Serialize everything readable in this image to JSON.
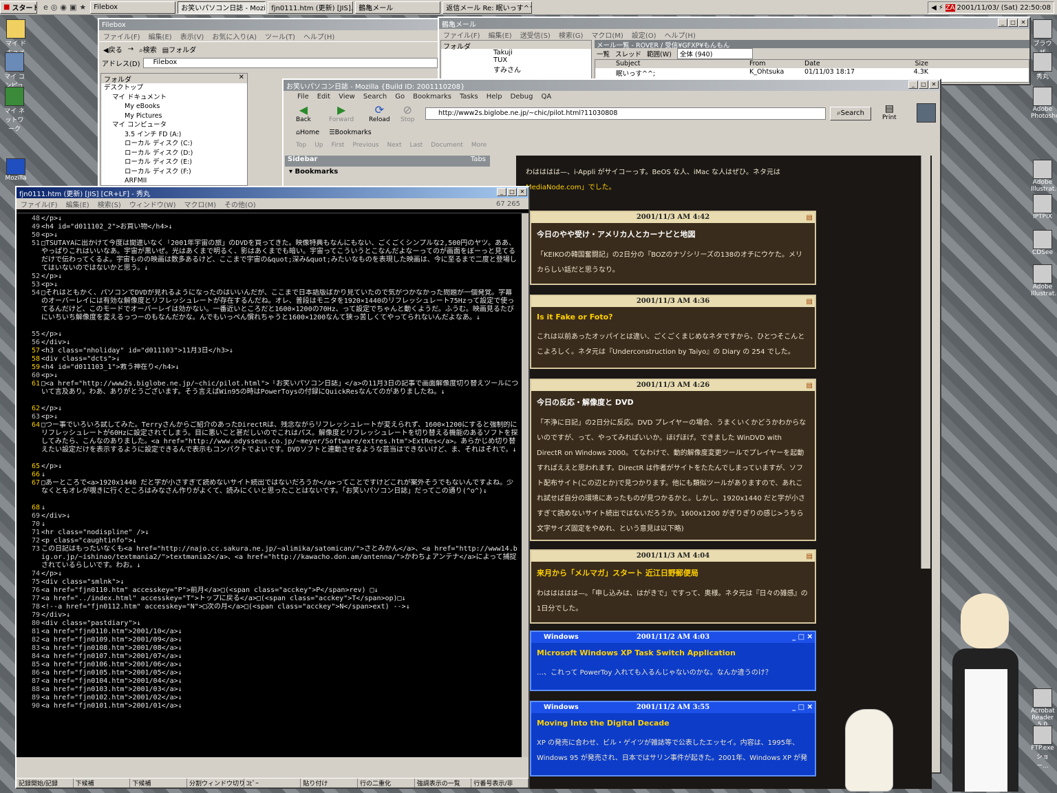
{
  "taskbar": {
    "start": "スタート",
    "tasks": [
      "Filebox",
      "お笑いパソコン日誌 - Mozi...",
      "fjn0111.htm (更新) [JIS]...",
      "鶴亀メール",
      "返信メール Re: 眠いっす^^..."
    ],
    "clock": "2001/11/03/ (Sat) 22:50:08"
  },
  "desktop": {
    "icons_left": [
      "マイ ドキュメント",
      "マイ コンピュータ",
      "マイ ネットワーク",
      "Mozilla"
    ],
    "icons_right": [
      "ブラウザ",
      "秀丸",
      "Adobe Photosho...",
      "Adobe Illustrat...",
      "IPTPIX",
      "CDSee",
      "Adobe Illustrat...",
      "Acrobat Reader 5.0",
      "FTP.exe ショー..."
    ]
  },
  "filebox": {
    "title": "Filebox",
    "menu": [
      "ファイル(F)",
      "編集(E)",
      "表示(V)",
      "お気に入り(A)",
      "ツール(T)",
      "ヘルプ(H)"
    ],
    "toolbar": [
      "戻る",
      "→",
      "検索",
      "フォルダ"
    ],
    "address_label": "アドレス(D)",
    "address": "Filebox",
    "folder_label": "フォルダ",
    "tree": [
      "デスクトップ",
      "マイ ドキュメント",
      "My eBooks",
      "My Pictures",
      "マイ コンピュータ",
      "3.5 インチ FD (A:)",
      "ローカル ディスク (C:)",
      "ローカル ディスク (D:)",
      "ローカル ディスク (E:)",
      "ローカル ディスク (F:)",
      "ARFMII"
    ]
  },
  "mail": {
    "title": "鶴亀メール",
    "menu": [
      "ファイル(F)",
      "編集(E)",
      "送受信(S)",
      "検索(G)",
      "マクロ(M)",
      "設定(O)",
      "ヘルプ(H)"
    ],
    "folder_label": "フォルダ",
    "path": "メール一覧 - ROVER / 受信¥GFXP¥もんもん",
    "folders": [
      "Takuji",
      "TUX",
      "すみさん"
    ],
    "tabs": [
      "一覧",
      "スレッド",
      "範囲(W)"
    ],
    "range": "全体 (940)",
    "cols": [
      "Subject",
      "From",
      "Date",
      "Size"
    ],
    "row": [
      "眠いっす^^;",
      "K_Ohtsuka",
      "01/11/03 18:17",
      "4.3K"
    ]
  },
  "mozilla": {
    "title": "お笑いパソコン日誌 - Mozilla {Build ID: 2001110208}",
    "menu": [
      "File",
      "Edit",
      "View",
      "Search",
      "Go",
      "Bookmarks",
      "Tasks",
      "Help",
      "Debug",
      "QA"
    ],
    "nav": [
      "Back",
      "Forward",
      "Reload",
      "Stop"
    ],
    "url": "http://www2s.biglobe.ne.jp/~chic/pilot.html?11030808",
    "search": "Search",
    "print": "Print",
    "personal": [
      "Home",
      "Bookmarks"
    ],
    "sitenav": [
      "Top",
      "Up",
      "First",
      "Previous",
      "Next",
      "Last",
      "Document",
      "More"
    ],
    "sidebar": "Sidebar",
    "tabs": "Tabs",
    "bookmarks": "Bookmarks"
  },
  "blog": {
    "top_text": "わはははは—、i-Appli がサイコーっす。BeOS な人、iMac な人はぜひ。ネタ元は",
    "top_link": "MediaNode.com」でした。",
    "entries": [
      {
        "date": "2001/11/3 AM 4:42",
        "head": "今日のやや受け・アメリカ人とカーナビと地図",
        "body": "「KEIKOの韓国奮闘記」の2日分の『BOZのナゾシリーズの138のオチにウケた。メリカらしい話だと思うなり。"
      },
      {
        "date": "2001/11/3 AM 4:36",
        "head": "Is it Fake or Foto?",
        "body": "これは以前あったオッパイとは違い、ごくごくまじめなネタですから、ひとつそこんとこよろしく。ネタ元は『Underconstruction by Taiyo』の Diary の 254 でした。"
      },
      {
        "date": "2001/11/3 AM 4:26",
        "head": "今日の反応・解像度と DVD",
        "body": "「不浄に日記」の2日分に反応。DVD プレイヤーの場合、うまくいくかどうかわからないのですが、って、やってみればいいか。ほげほげ。できました WinDVD with DirectR on Windows 2000。てなわけで、動的解像度変更ツールでプレイヤーを起動すればええと思われます。DirectR は作者がサイトをたたんでしまっていますが、ソフト配布サイト(この辺とか)で見つかります。他にも類似ツールがありますので、あれこれ試せば自分の環境にあったものが見つかるかと。しかし、1920x1440 だと字が小さすぎて読めないサイト続出ではないだろうか。1600x1200 がぎりぎりの感じ>うちら文字サイズ固定をやめれ、という意見は以下略)"
      },
      {
        "date": "2001/11/3 AM 4:04",
        "head": "来月から「メルマガ」スタート 近江日野郵便局",
        "body": "わははははは—。「申し込みは、はがきで」ですって、奥様。ネタ元は『日々の雑感』の1日分でした。"
      },
      {
        "date": "2001/11/2 AM 4:03",
        "head": "Microsoft Windows XP Task Switch Application",
        "body": "…、これって PowerToy 入れても入るんじゃないのかな。なんか違うのけ？",
        "brand": "Windows"
      },
      {
        "date": "2001/11/2 AM 3:55",
        "head": "Moving Into the Digital Decade",
        "body": "XP の発売に合わせ、ビル・ゲイツが雑誌等で公表したエッセイ。内容は、1995年、Windows 95 が発売され、日本ではサリン事件が起きた。2001年、Windows XP が発",
        "brand": "Windows"
      }
    ]
  },
  "editor": {
    "title": "fjn0111.htm (更新) [JIS] [CR+LF] - 秀丸",
    "menu": [
      "ファイル(F)",
      "編集(E)",
      "検索(S)",
      "ウィンドウ(W)",
      "マクロ(M)",
      "その他(O)"
    ],
    "pos": "67 265",
    "lines": [
      {
        "n": "48",
        "t": "</p>↓"
      },
      {
        "n": "49",
        "t": "<h4 id=\"d011102_2\">お買い物</h4>↓"
      },
      {
        "n": "50",
        "t": "<p>↓"
      },
      {
        "n": "51",
        "t": "□TSUTAYAに出かけて今度は間違いなく「2001年宇宙の旅」のDVDを買ってきた。映像特典もなんにもない、ごくごくシンプルな2,500円のヤツ。ああ、やっぱりこれはいいなあ。宇宙が黒いぜ。光はあくまで明るく、影はあくまでも暗い。宇宙ってこういうとこなんだよなーってのが画面をぼーっと見てるだけで伝わってくるよ。宇宙ものの映画は数多あるけど、ここまで宇宙の&quot;深み&quot;みたいなものを表現した映画は、今に至るまで二度と登場してはいないのではないかと思う。↓",
        "h": 48
      },
      {
        "n": "52",
        "t": "</p>↓"
      },
      {
        "n": "53",
        "t": "<p>↓"
      },
      {
        "n": "54",
        "t": "□それはともかく、パソコンでDVDが見れるようになったのはいいんだが、ここまで日本語版ばかり見ていたので気がつかなかった問題が一個発覚。字幕のオーバーレイには有効な解像度とリフレッシュレートが存在するんだね。オレ、普段はモニタを1920×1440のリフレッシュレート75Hzって設定で使ってるんだけど、このモードでオーバーレイは効かない。一番近いところだと1600×1200の70Hz、って設定でちゃんと動くようだ。ふうむ。映画見るたびにいちいち解像度を変えるっつーのもなんだかな。んでもいっぺん慣れちゃうと1600×1200なんて狭っ苦しくてやってられないんだよなあ。↓",
        "h": 60
      },
      {
        "n": "55",
        "t": "</p>↓"
      },
      {
        "n": "56",
        "t": "</div>↓"
      },
      {
        "n": "57",
        "t": "<h3 class=\"nholiday\" id=\"d011103\">11月3日</h3>↓",
        "y": 1
      },
      {
        "n": "58",
        "t": "<div class=\"dcts\">↓",
        "y": 1
      },
      {
        "n": "59",
        "t": "<h4 id=\"d011103_1\">救う神在り</h4>↓",
        "y": 1
      },
      {
        "n": "60",
        "t": "<p>↓"
      },
      {
        "n": "61",
        "t": "□<a href=\"http://www2s.biglobe.ne.jp/~chic/pilot.html\">「お笑いパソコン日誌」</a>の11月3日の記事で画面解像度切り替えツールについて言及あり。わあ、ありがとうございます。そう言えばWin95の時はPowerToysの付録にQuickResなんてのがありましたね。↓",
        "y": 1,
        "h": 36
      },
      {
        "n": "62",
        "t": "</p>↓",
        "y": 1
      },
      {
        "n": "63",
        "t": "<p>↓"
      },
      {
        "n": "64",
        "t": "□つー事でいろいろ試してみた。Terryさんからご紹介のあったDirectRは、残念ながらリフレッシュレートが変えられず、1600×1200にすると強制的にリフレッシュレートが60Hzに設定されてしまう。目に悪いこと甚だしいのでこれはパス。解像度とリフレッシュレートを切り替える機能のあるソフトを探してみたら、こんなのありました。<a href=\"http://www.odysseus.co.jp/~meyer/Software/extres.htm\">ExtRes</a>。あらかじめ切り替えたい設定だけを表示するように設定できるんで表示もコンパクトでよいです。DVDソフトと連動させるような芸当はできないけど、ま、それはそれで。↓",
        "y": 1,
        "h": 60
      },
      {
        "n": "65",
        "t": "</p>↓",
        "y": 1
      },
      {
        "n": "66",
        "t": "↓",
        "y": 1
      },
      {
        "n": "67",
        "t": "□あーところで<a>1920x1440 だと字が小さすぎて読めないサイト続出ではないだろうか</a>ってことですけどこれが案外そうでもないんですよね。少なくともオレが覗きに行くところはみなさん作りがよくて、読みにくいと思ったことはないです。「お笑いパソコン日誌」だってこの通り(^o^)↓",
        "y": 1,
        "h": 36
      },
      {
        "n": "68",
        "t": "↓",
        "y": 1
      },
      {
        "n": "69",
        "t": "</div>↓"
      },
      {
        "n": "70",
        "t": "↓"
      },
      {
        "n": "71",
        "t": "<hr class=\"nodispline\" />↓"
      },
      {
        "n": "72",
        "t": "<p class=\"caughtinfo\">↓"
      },
      {
        "n": "73",
        "t": "この日記はもったいなくも<a href=\"http://najo.cc.sakura.ne.jp/~alimika/satomican/\">さとみかん</a>、<a href=\"http://www14.big.or.jp/~ishinao/textmania2/\">textmania2</a>、<a href=\"http://kawacho.don.am/antenna/\">かわちょアンテナ</a>によって捕捉されているらしいです。わお。↓",
        "h": 36
      },
      {
        "n": "74",
        "t": "</p>↓"
      },
      {
        "n": "75",
        "t": "<div class=\"smlnk\">↓"
      },
      {
        "n": "76",
        "t": "<a href=\"fjn0110.htm\" accesskey=\"P\">前月</a>□(<span class=\"acckey\">P</span>rev) □↓"
      },
      {
        "n": "77",
        "t": "<a href=\"../index.html\" accesskey=\"T\">トップに戻る</a>□(<span class=\"acckey\">T</span>op)□↓"
      },
      {
        "n": "78",
        "t": "<!--a href=\"fjn0112.htm\" accesskey=\"N\">□次の月</a>□(<span class=\"acckey\">N</span>ext) -->↓"
      },
      {
        "n": "79",
        "t": "</div>↓"
      },
      {
        "n": "80",
        "t": "<div class=\"pastdiary\">↓"
      },
      {
        "n": "81",
        "t": "<a href=\"fjn0110.htm\">2001/10</a>↓"
      },
      {
        "n": "82",
        "t": "<a href=\"fjn0109.htm\">2001/09</a>↓"
      },
      {
        "n": "83",
        "t": "<a href=\"fjn0108.htm\">2001/08</a>↓"
      },
      {
        "n": "84",
        "t": "<a href=\"fjn0107.htm\">2001/07</a>↓"
      },
      {
        "n": "85",
        "t": "<a href=\"fjn0106.htm\">2001/06</a>↓"
      },
      {
        "n": "86",
        "t": "<a href=\"fjn0105.htm\">2001/05</a>↓"
      },
      {
        "n": "87",
        "t": "<a href=\"fjn0104.htm\">2001/04</a>↓"
      },
      {
        "n": "88",
        "t": "<a href=\"fjn0103.htm\">2001/03</a>↓"
      },
      {
        "n": "89",
        "t": "<a href=\"fjn0102.htm\">2001/02</a>↓"
      },
      {
        "n": "90",
        "t": "<a href=\"fjn0101.htm\">2001/01</a>↓"
      }
    ],
    "status": [
      "記録開始/記録",
      "下候補",
      "下候補",
      "分割ウィンドウ切り抜き",
      "ｺﾋﾟｰ",
      "貼り付け",
      "行の二重化",
      "強調表示の一覧",
      "行番号表示/非"
    ]
  },
  "colors": {
    "taskbar": "#d4d0c8",
    "title_active": "#0a246a",
    "editor_bg": "#000000",
    "blog_entry": "#3a2c1c",
    "xp_blue": "#0c3cc8"
  }
}
